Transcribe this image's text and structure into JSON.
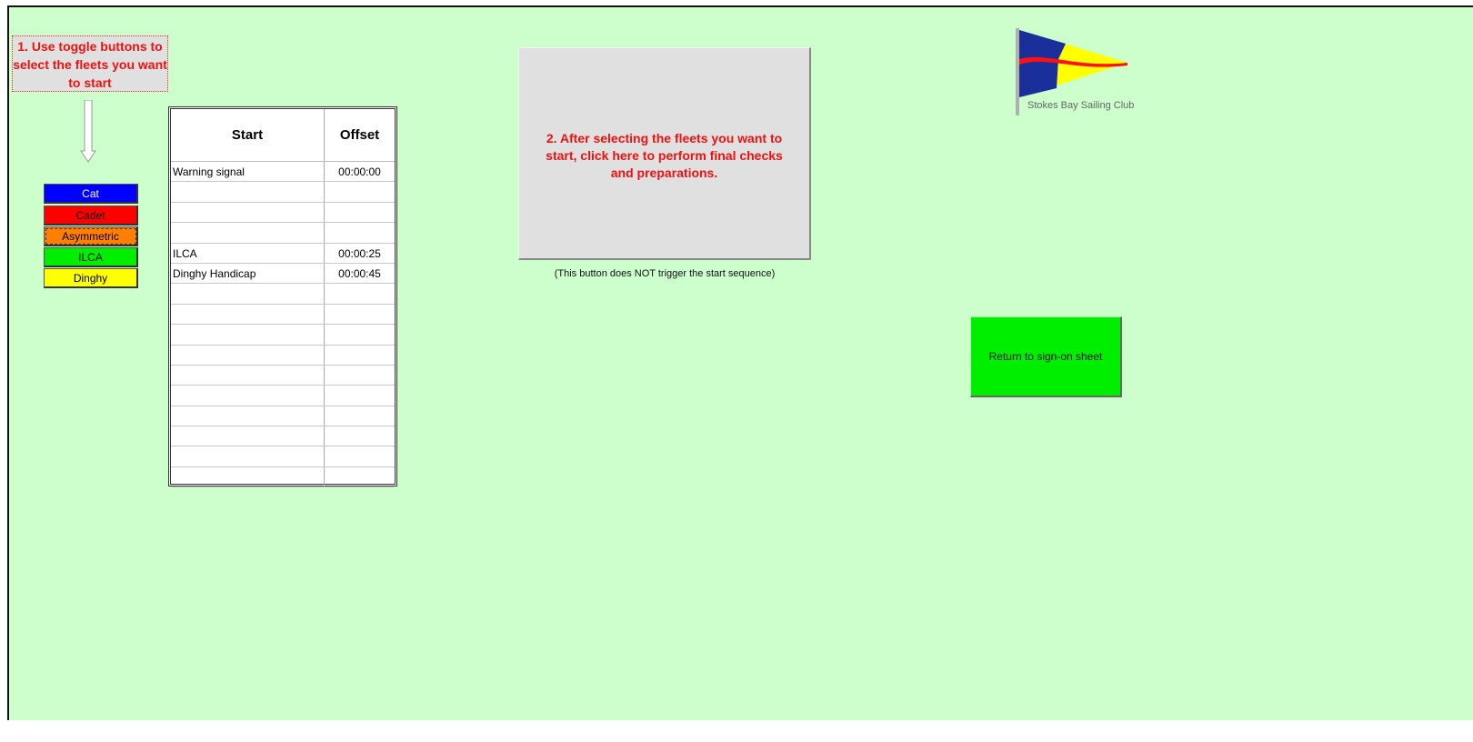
{
  "instructions": {
    "step1": "1.  Use toggle buttons to select the fleets you want to start",
    "step2": "2.  After selecting the fleets you want to start,  click  here  to  perform  final checks and preparations.",
    "note": "(This button does NOT trigger the start sequence)"
  },
  "toggles": [
    {
      "label": "Cat",
      "color": "#0000ff",
      "text_color": "#ffffff",
      "pressed": false
    },
    {
      "label": "Cadet",
      "color": "#ff0000",
      "text_color": "#000000",
      "pressed": false
    },
    {
      "label": "Asymmetric",
      "color": "#ff8000",
      "text_color": "#000000",
      "pressed": true
    },
    {
      "label": "ILCA",
      "color": "#00ee00",
      "text_color": "#000000",
      "pressed": false
    },
    {
      "label": "Dinghy",
      "color": "#ffff00",
      "text_color": "#000000",
      "pressed": false
    }
  ],
  "table": {
    "headers": {
      "start": "Start",
      "offset": "Offset"
    },
    "rows": [
      {
        "start": "Warning signal",
        "offset": "00:00:00"
      },
      {
        "start": "",
        "offset": ""
      },
      {
        "start": "",
        "offset": ""
      },
      {
        "start": "",
        "offset": ""
      },
      {
        "start": "ILCA",
        "offset": "00:00:25"
      },
      {
        "start": "Dinghy Handicap",
        "offset": "00:00:45"
      },
      {
        "start": "",
        "offset": ""
      },
      {
        "start": "",
        "offset": ""
      },
      {
        "start": "",
        "offset": ""
      },
      {
        "start": "",
        "offset": ""
      },
      {
        "start": "",
        "offset": ""
      },
      {
        "start": "",
        "offset": ""
      },
      {
        "start": "",
        "offset": ""
      },
      {
        "start": "",
        "offset": ""
      },
      {
        "start": "",
        "offset": ""
      },
      {
        "start": "",
        "offset": ""
      }
    ]
  },
  "logo": {
    "club_name": "Stokes Bay Sailing Club",
    "icon": "burgee-flag-icon"
  },
  "return_button": {
    "label": "Return to sign-on sheet",
    "color": "#00ee00"
  },
  "colors": {
    "sheet_background": "#ccffcc",
    "instruction_text": "#ee1111"
  }
}
